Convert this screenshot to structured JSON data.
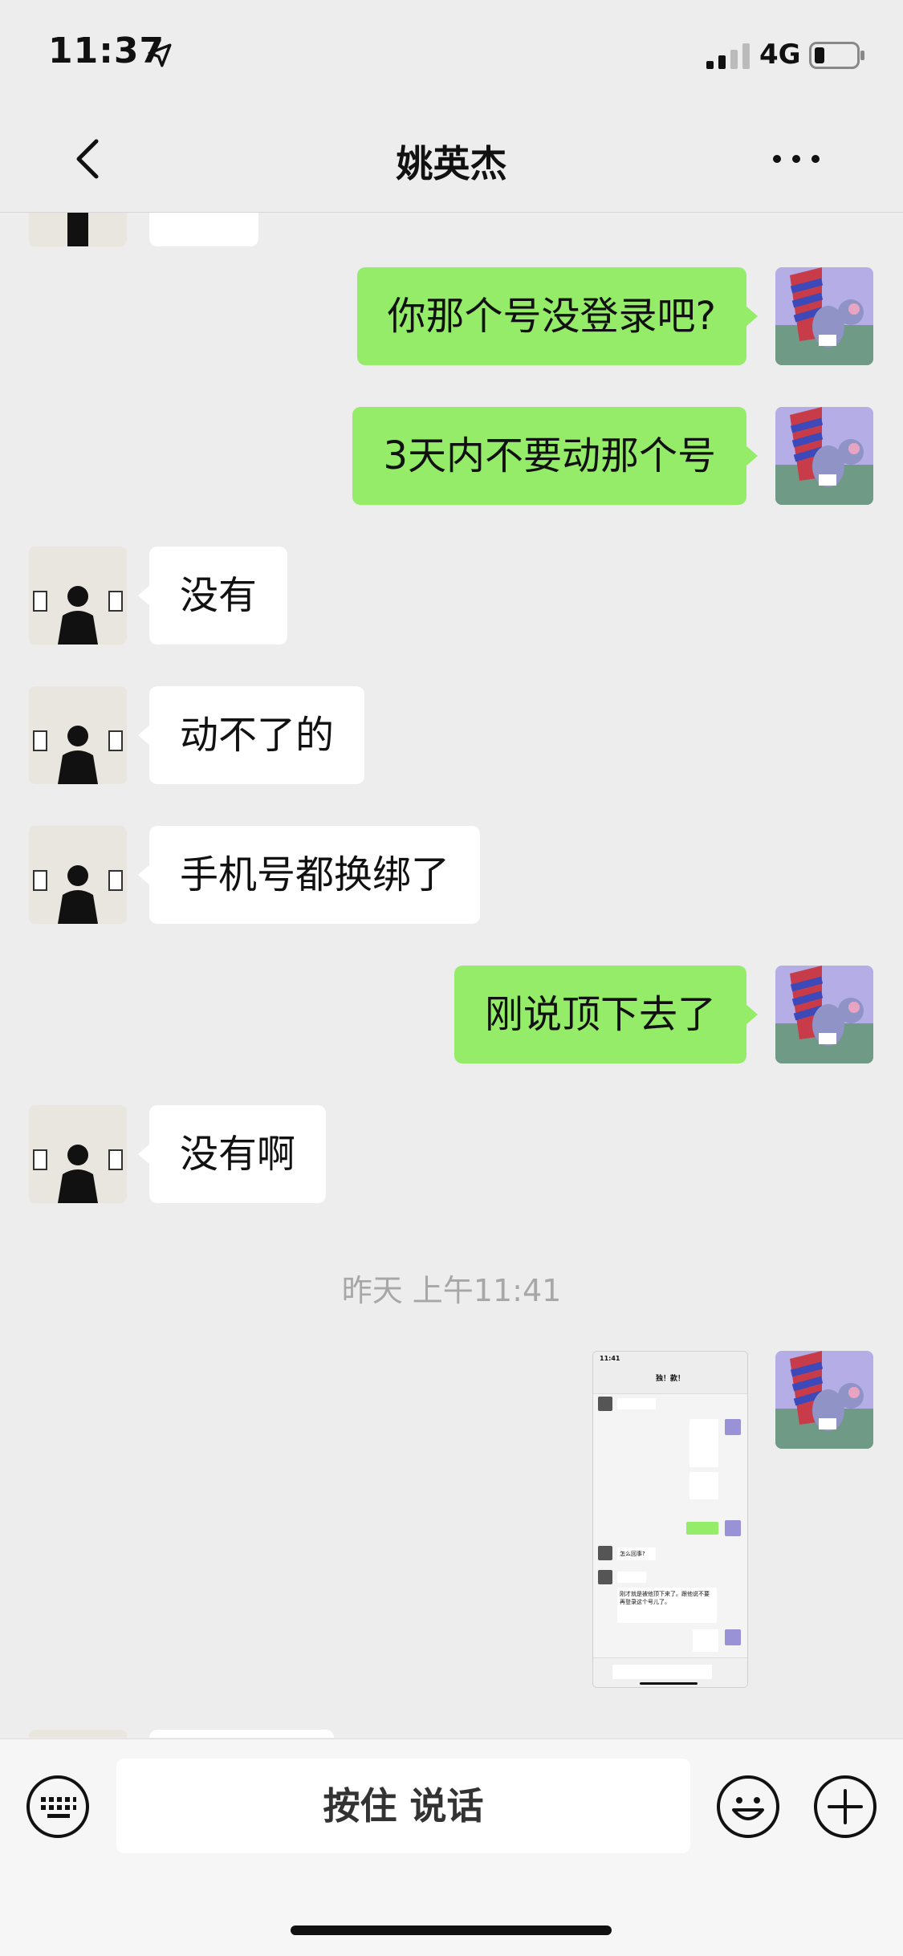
{
  "status_bar": {
    "time": "11:37",
    "network": "4G"
  },
  "header": {
    "title": "姚英杰"
  },
  "messages": [
    {
      "side": "out",
      "text": "你那个号没登录吧?"
    },
    {
      "side": "out",
      "text": "3天内不要动那个号"
    },
    {
      "side": "in",
      "text": "没有"
    },
    {
      "side": "in",
      "text": "动不了的"
    },
    {
      "side": "in",
      "text": "手机号都换绑了"
    },
    {
      "side": "out",
      "text": "刚说顶下去了"
    },
    {
      "side": "in",
      "text": "没有啊"
    }
  ],
  "timestamp": "昨天 上午11:41",
  "image_message": {
    "side": "out",
    "thumbnail": {
      "time": "11:41",
      "title": "独！款！",
      "texts": [
        "怎么回事?",
        "刚才就是被他顶下来了。跟他说不要再登录这个号儿了。"
      ]
    }
  },
  "input_bar": {
    "hold_to_talk": "按住 说话"
  },
  "icons": {
    "back": "chevron-left-icon",
    "more": "more-dots-icon",
    "keyboard": "keyboard-icon",
    "emoji": "emoji-icon",
    "plus": "plus-icon"
  },
  "colors": {
    "outgoing_bubble": "#95ec69",
    "incoming_bubble": "#ffffff",
    "background": "#ededed"
  }
}
